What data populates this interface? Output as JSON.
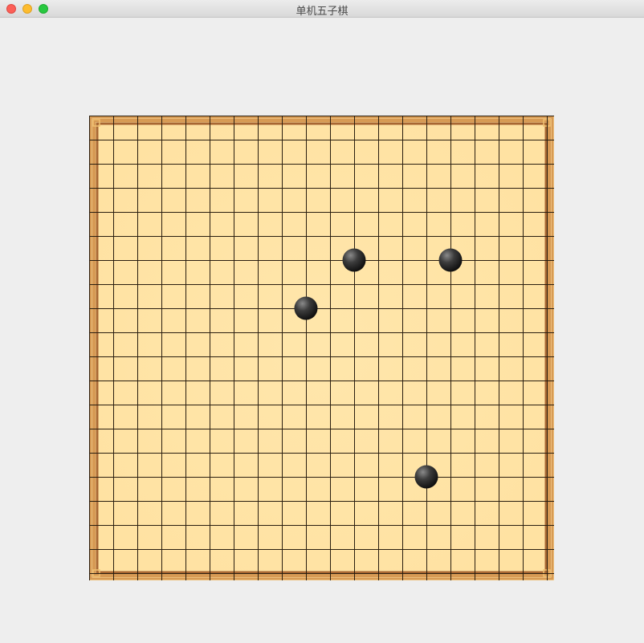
{
  "window": {
    "title": "单机五子棋"
  },
  "board": {
    "lines": 20,
    "colors": {
      "wood": "#ffe4a5",
      "frame_outer": "#d79a54",
      "frame_inner": "#a86733",
      "grid": "#2a1e10"
    },
    "stones": [
      {
        "color": "black",
        "col": 11,
        "row": 6
      },
      {
        "color": "black",
        "col": 15,
        "row": 6
      },
      {
        "color": "black",
        "col": 9,
        "row": 8
      },
      {
        "color": "black",
        "col": 14,
        "row": 15
      }
    ]
  }
}
